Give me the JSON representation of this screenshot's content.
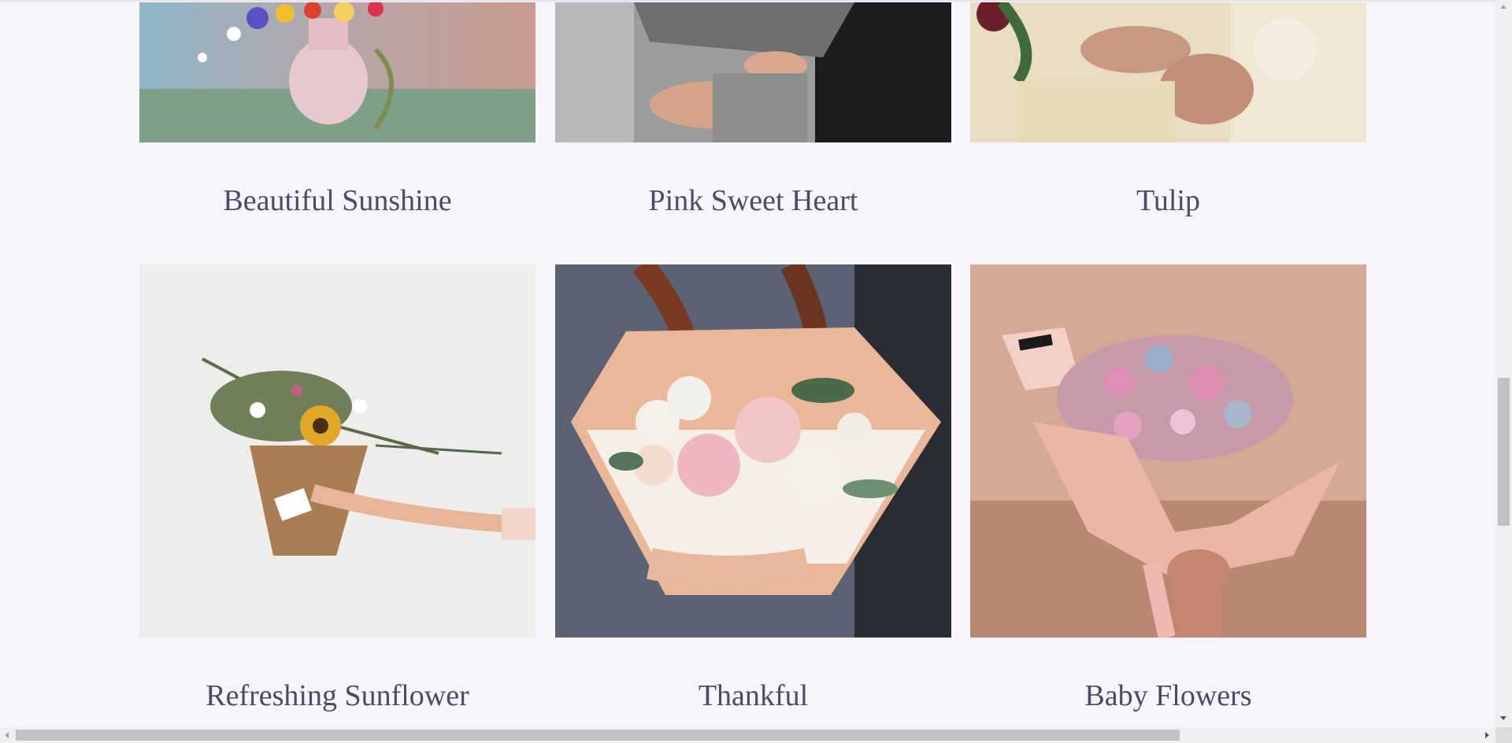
{
  "products": [
    {
      "title": "Beautiful Sunshine",
      "image": "flowers-in-pink-vase"
    },
    {
      "title": "Pink Sweet Heart",
      "image": "bouquet-in-grey-paper"
    },
    {
      "title": "Tulip",
      "image": "bridal-bouquet"
    },
    {
      "title": "Refreshing Sunflower",
      "image": "sunflower-bouquet-in-kraft-paper"
    },
    {
      "title": "Thankful",
      "image": "rose-bouquet-held"
    },
    {
      "title": "Baby Flowers",
      "image": "baby-breath-bouquet"
    }
  ]
}
